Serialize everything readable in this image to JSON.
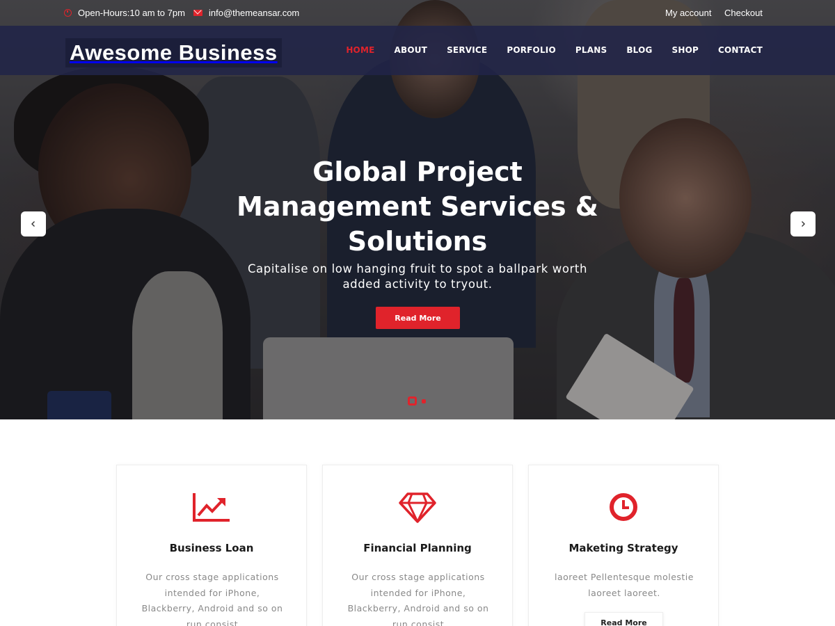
{
  "topbar": {
    "hours": "Open-Hours:10 am to 7pm",
    "email": "info@themeansar.com",
    "my_account": "My account",
    "checkout": "Checkout"
  },
  "brand": {
    "name": "Awesome Business"
  },
  "nav": {
    "items": [
      {
        "label": "HOME",
        "active": true
      },
      {
        "label": "ABOUT"
      },
      {
        "label": "SERVICE"
      },
      {
        "label": "PORFOLIO"
      },
      {
        "label": "PLANS"
      },
      {
        "label": "BLOG"
      },
      {
        "label": "SHOP"
      },
      {
        "label": "CONTACT"
      }
    ]
  },
  "hero": {
    "title_line1": "Global Project",
    "title_line2": "Management Services &",
    "title_line3": "Solutions",
    "subtitle_line1": "Capitalise on low hanging fruit to spot a ballpark worth",
    "subtitle_line2": "added activity to tryout.",
    "button": "Read More",
    "slide_count": 2,
    "active_slide": 1
  },
  "features": [
    {
      "icon": "chart-up-icon",
      "title": "Business Loan",
      "text_line1": "Our cross stage applications",
      "text_line2": "intended for iPhone,",
      "text_line3": "Blackberry, Android and so on",
      "text_line4": "run consist"
    },
    {
      "icon": "diamond-icon",
      "title": "Financial Planning",
      "text_line1": "Our cross stage applications",
      "text_line2": "intended for iPhone,",
      "text_line3": "Blackberry, Android and so on",
      "text_line4": "run consist"
    },
    {
      "icon": "clock-icon",
      "title": "Maketing Strategy",
      "text_line1": "laoreet Pellentesque molestie",
      "text_line2": "laoreet laoreet.",
      "button": "Read More"
    }
  ],
  "colors": {
    "accent": "#e0232b",
    "nav_bg": "#212448"
  }
}
